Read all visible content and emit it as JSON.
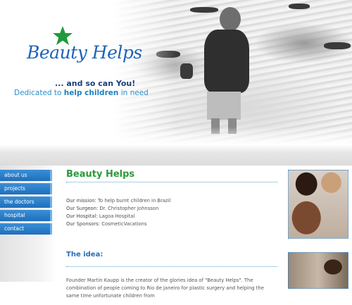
{
  "brand": {
    "name": "Beauty Helps",
    "tagline_1": "... and so can You!",
    "tagline_2_start": "Dedicated to ",
    "tagline_2_bold": "help children",
    "tagline_2_end": " in need",
    "star_color": "#1f9a3a",
    "logo_color": "#1e63b8"
  },
  "nav": {
    "items": [
      {
        "label": "about us"
      },
      {
        "label": "projects"
      },
      {
        "label": "the doctors"
      },
      {
        "label": "hospital"
      },
      {
        "label": "contact"
      }
    ]
  },
  "main": {
    "title": "Beauty Helps",
    "mission_label": "Our mission:",
    "mission_value": "To help burnt children in Brazil",
    "surgeon_label": "Our Surgeon:",
    "surgeon_value": "Dr. Christopher Johnsson",
    "hospital_label": "Our Hospital:",
    "hospital_value": "Lagoa Hospital",
    "sponsors_label": "Our Sponsors:",
    "sponsors_value": "CosmeticVacations",
    "idea_title": "The idea:",
    "idea_text": "Founder Martin Kaupp is the creator of the glories idea of \"Beauty Helps\". The combination of people coming to Rio de Janeiro for plastic surgery and helping the same time unfortunate children from"
  },
  "colors": {
    "nav_bg": "#1f6fbd",
    "title_green": "#2a9a3a",
    "idea_blue": "#2a6db5"
  }
}
